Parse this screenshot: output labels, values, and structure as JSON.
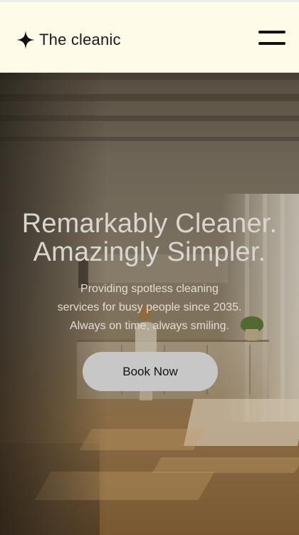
{
  "header": {
    "brand_name": "The cleanic",
    "brand_icon": "sparkle-icon",
    "menu_icon": "hamburger-menu-icon"
  },
  "hero": {
    "headline_line1": "Remarkably Cleaner.",
    "headline_line2": "Amazingly Simpler.",
    "tagline_line1": "Providing spotless cleaning",
    "tagline_line2": "services for busy people since 2035.",
    "tagline_line3": "Always on time, always smiling.",
    "cta_label": "Book Now",
    "background_image": "bright kitchen interior with person cleaning"
  },
  "colors": {
    "header_bg": "#fefbe9",
    "headline_text": "#d9d6cf",
    "button_bg": "#c7c7c7"
  }
}
